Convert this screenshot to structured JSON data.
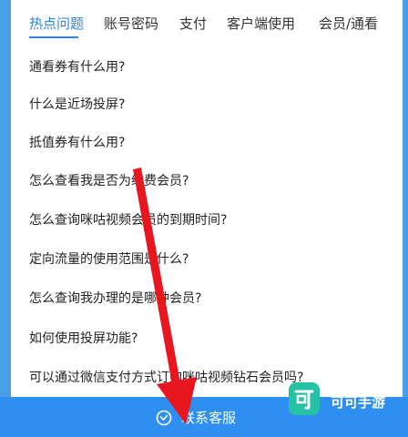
{
  "tabs": [
    {
      "label": "热点问题",
      "active": true
    },
    {
      "label": "账号密码",
      "active": false
    },
    {
      "label": "支付",
      "active": false
    },
    {
      "label": "客户端使用",
      "active": false
    },
    {
      "label": "会员/通看",
      "active": false
    }
  ],
  "faq": [
    "通看券有什么用?",
    "什么是近场投屏?",
    "抵值券有什么用?",
    "怎么查看我是否为续费会员?",
    "怎么查询咪咕视频会员的到期时间?",
    "定向流量的使用范围是什么?",
    "怎么查询我办理的是哪种会员?",
    "如何使用投屏功能?",
    "可以通过微信支付方式订购咪咕视频钻石会员吗?"
  ],
  "footer": {
    "contact_label": "联系客服"
  },
  "watermark": {
    "text": "可可手游"
  },
  "colors": {
    "accent": "#2a86e0",
    "footer_bg": "#2f8ff0",
    "arrow": "#e8161f",
    "watermark_logo": "#25c2a5"
  }
}
